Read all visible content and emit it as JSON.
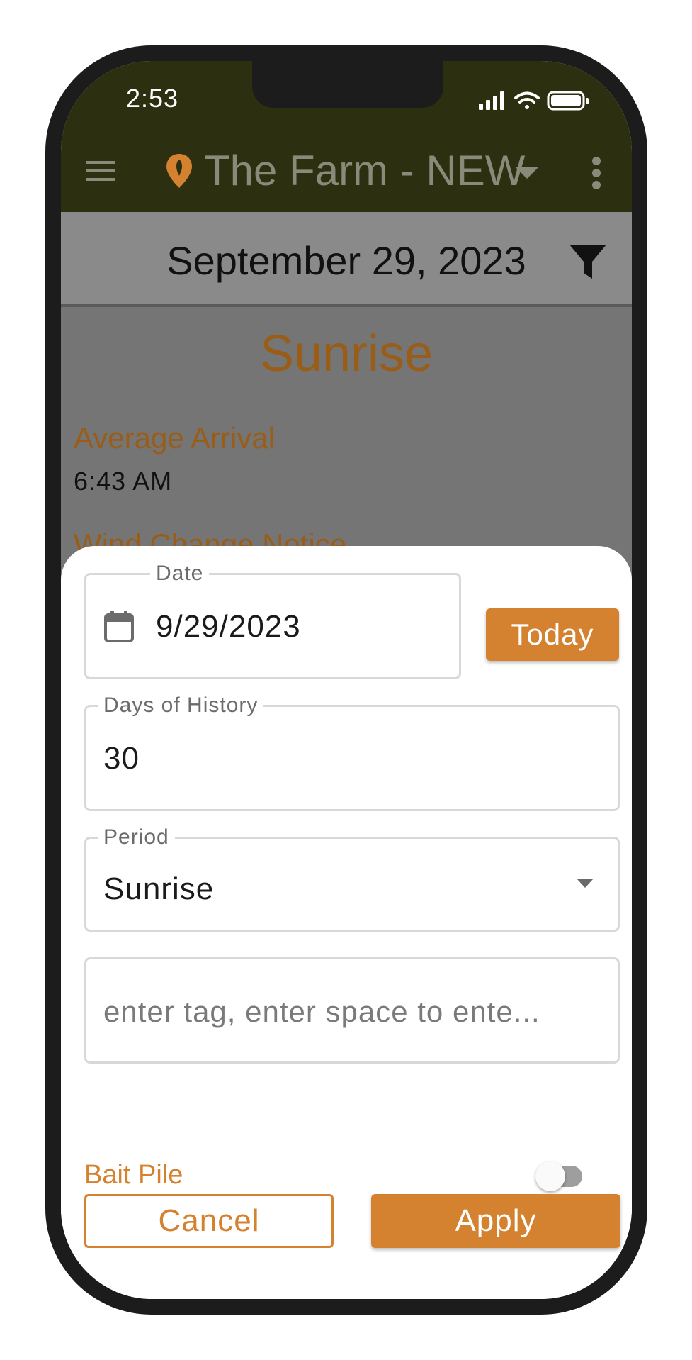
{
  "status_bar": {
    "time": "2:53"
  },
  "app_bar": {
    "title": "The Farm - NEW"
  },
  "date_header": {
    "date": "September 29, 2023"
  },
  "content": {
    "section_title": "Sunrise",
    "average_arrival_label": "Average Arrival",
    "average_arrival_value": "6:43 AM",
    "wind_change_label": "Wind Change Notice"
  },
  "filter_sheet": {
    "date_field": {
      "label": "Date",
      "value": "9/29/2023"
    },
    "today_button": "Today",
    "history_field": {
      "label": "Days of History",
      "value": "30"
    },
    "period_field": {
      "label": "Period",
      "value": "Sunrise"
    },
    "tag_input": {
      "placeholder": "enter tag, enter space to ente..."
    },
    "bait_pile": {
      "label": "Bait Pile",
      "enabled": false
    },
    "cancel_button": "Cancel",
    "apply_button": "Apply"
  },
  "colors": {
    "accent": "#d4822f",
    "app_bar": "#2d3010",
    "section_title": "#9a5d18"
  },
  "icons": [
    "menu-icon",
    "location-pin-icon",
    "chevron-down-icon",
    "more-vert-icon",
    "filter-icon",
    "calendar-icon",
    "dropdown-arrow-icon"
  ]
}
